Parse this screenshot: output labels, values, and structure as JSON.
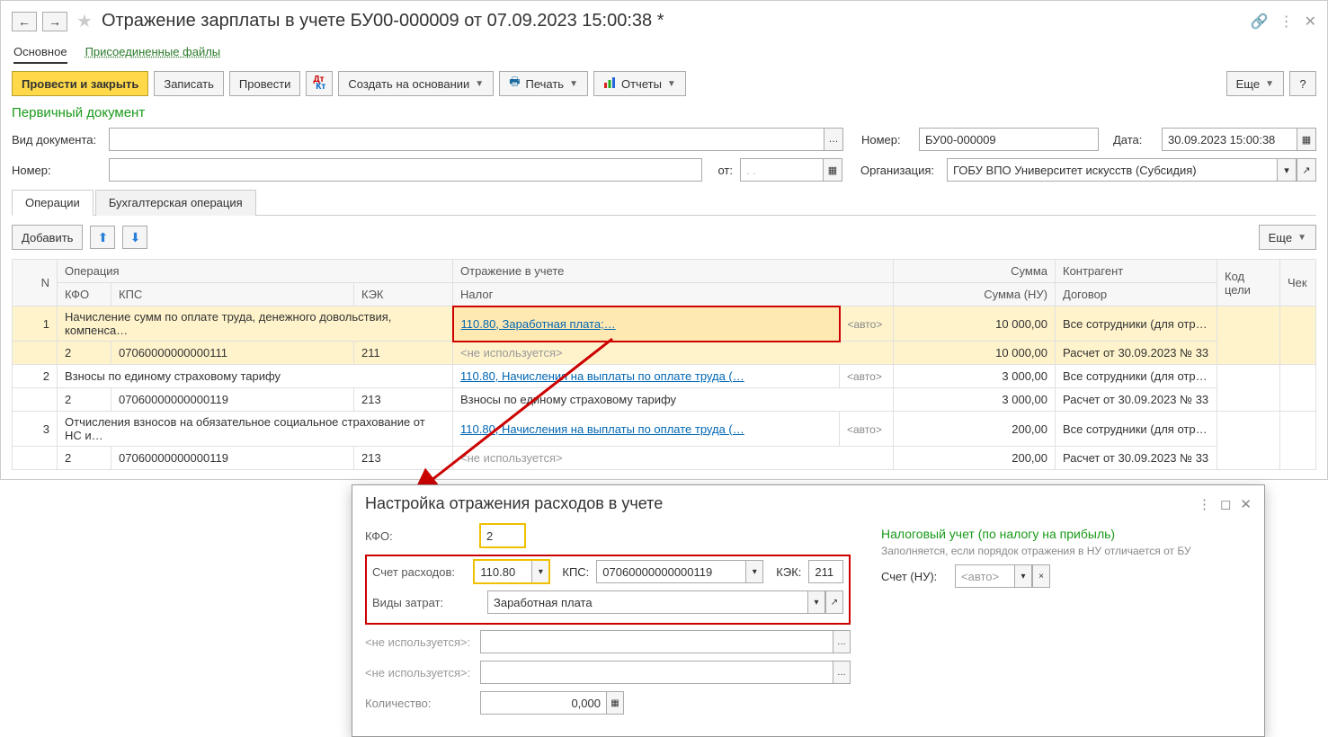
{
  "title": "Отражение зарплаты в учете БУ00-000009 от 07.09.2023 15:00:38 *",
  "mainTabs": {
    "main": "Основное",
    "files": "Присоединенные файлы"
  },
  "toolbar": {
    "postClose": "Провести и закрыть",
    "write": "Записать",
    "post": "Провести",
    "createBased": "Создать на основании",
    "print": "Печать",
    "reports": "Отчеты",
    "more": "Еще",
    "help": "?"
  },
  "section": "Первичный документ",
  "form": {
    "docTypeLbl": "Вид документа:",
    "numberLbl": "Номер:",
    "fromLbl": "от:",
    "fromVal": "  .   .",
    "numLbl": "Номер:",
    "numVal": "БУ00-000009",
    "dateLbl": "Дата:",
    "dateVal": "30.09.2023 15:00:38",
    "orgLbl": "Организация:",
    "orgVal": "ГОБУ ВПО Университет искусств (Субсидия)"
  },
  "innerTabs": {
    "ops": "Операции",
    "acct": "Бухгалтерская операция"
  },
  "tableToolbar": {
    "add": "Добавить",
    "more": "Еще"
  },
  "cols": {
    "n": "N",
    "op": "Операция",
    "refl": "Отражение в учете",
    "sum": "Сумма",
    "contr": "Контрагент",
    "goal": "Код цели",
    "chk": "Чек",
    "kfo": "КФО",
    "kps": "КПС",
    "kek": "КЭК",
    "tax": "Налог",
    "sumNU": "Сумма (НУ)",
    "dog": "Договор"
  },
  "rows": [
    {
      "n": "1",
      "op": "Начисление сумм по оплате труда, денежного довольствия, компенса…",
      "refl": "110.80, Заработная плата;…",
      "reflAuto": "<авто>",
      "sum": "10 000,00",
      "contr": "Все сотрудники (для отр…",
      "kfo": "2",
      "kps": "07060000000000111",
      "kek": "211",
      "tax": "<не используется>",
      "sumNU": "10 000,00",
      "dog": "Расчет от 30.09.2023 № 33",
      "highlight": true
    },
    {
      "n": "2",
      "op": "Взносы по единому страховому тарифу",
      "refl": "110.80, Начисления на выплаты по оплате труда (…",
      "reflAuto": "<авто>",
      "sum": "3 000,00",
      "contr": "Все сотрудники (для отр…",
      "kfo": "2",
      "kps": "07060000000000119",
      "kek": "213",
      "tax": "Взносы по единому страховому тарифу",
      "sumNU": "3 000,00",
      "dog": "Расчет от 30.09.2023 № 33"
    },
    {
      "n": "3",
      "op": "Отчисления взносов на обязательное социальное страхование от НС и…",
      "refl": "110.80, Начисления на выплаты по оплате труда (…",
      "reflAuto": "<авто>",
      "sum": "200,00",
      "contr": "Все сотрудники (для отр…",
      "kfo": "2",
      "kps": "07060000000000119",
      "kek": "213",
      "tax": "<не используется>",
      "sumNU": "200,00",
      "dog": "Расчет от 30.09.2023 № 33"
    }
  ],
  "dialog": {
    "title": "Настройка отражения расходов в учете",
    "kfoLbl": "КФО:",
    "kfoVal": "2",
    "acctLbl": "Счет расходов:",
    "acctVal": "110.80",
    "kpsLbl": "КПС:",
    "kpsVal": "07060000000000119",
    "kekLbl": "КЭК:",
    "kekVal": "211",
    "costLbl": "Виды затрат:",
    "costVal": "Заработная плата",
    "unused": "<не используется>:",
    "qtyLbl": "Количество:",
    "qtyVal": "0,000",
    "taxTitle": "Налоговый учет (по налогу на прибыль)",
    "taxNote": "Заполняется, если порядок отражения в НУ отличается от БУ",
    "taxAcctLbl": "Счет (НУ):",
    "taxAcctPh": "<авто>"
  }
}
